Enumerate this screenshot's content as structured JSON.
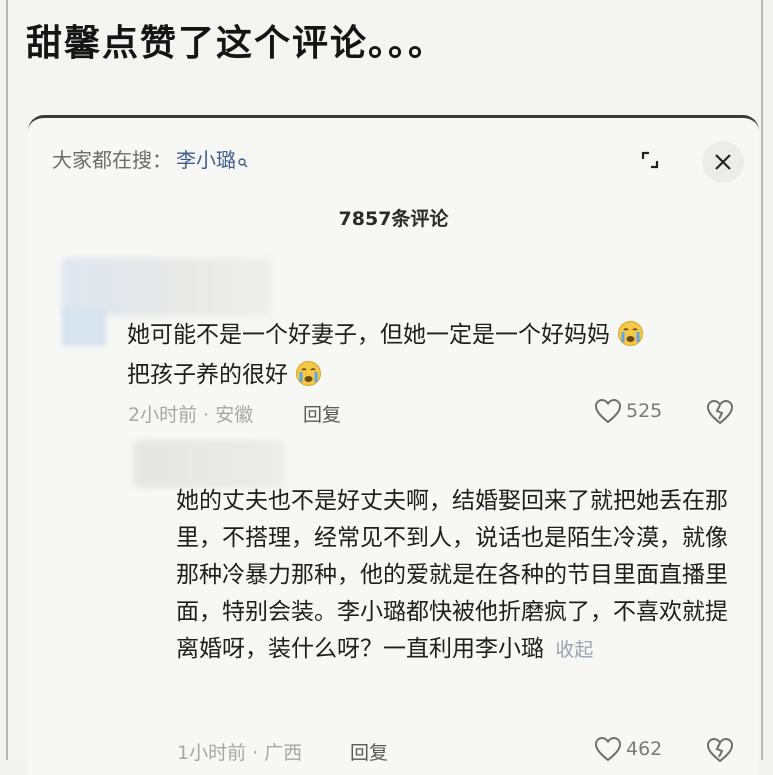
{
  "headline": "甜馨点赞了这个评论。。。",
  "header": {
    "search_prefix": "大家都在搜：",
    "search_term": "李小璐",
    "comment_count": "7857条评论"
  },
  "comments": [
    {
      "text_line1": "她可能不是一个好妻子，但她一定是一个好妈妈",
      "text_line2": "把孩子养的很好",
      "meta": "2小时前 · 安徽",
      "reply_label": "回复",
      "likes": "525"
    },
    {
      "text": "她的丈夫也不是好丈夫啊，结婚娶回来了就把她丢在那里，不搭理，经常见不到人，说话也是陌生冷漠，就像那种冷暴力那种，他的爱就是在各种的节目里面直播里面，特别会装。李小璐都快被他折磨疯了，不喜欢就提离婚呀，装什么呀？一直利用李小璐",
      "collapse_label": "收起",
      "meta": "1小时前 · 广西",
      "reply_label": "回复",
      "likes": "462"
    }
  ],
  "icons": {
    "search": "search-icon",
    "expand": "expand-icon",
    "close": "close-icon",
    "heart": "heart-icon",
    "dislike": "broken-heart-icon",
    "emoji": "crying-face-icon"
  }
}
